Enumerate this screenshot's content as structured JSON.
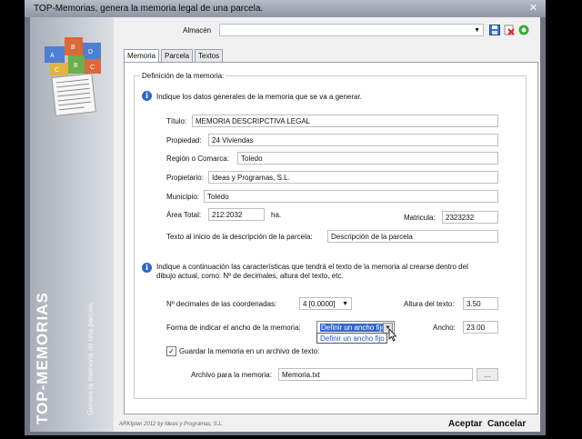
{
  "window": {
    "title": "TOP-Memorias, genera la memoria legal de una parcela.",
    "sidebar_title": "TOP-MEMORIAS",
    "sidebar_subtitle": "Genera la memoria de una parcela.",
    "copyright": "ARKIplan 2012 by Ideas y Programas, S.L."
  },
  "toolbar": {
    "almacen_label": "Almacén",
    "almacen_value": "",
    "icons": [
      "save-icon",
      "delete-icon",
      "refresh-icon"
    ]
  },
  "tabs": [
    {
      "label": "Memoria",
      "active": true
    },
    {
      "label": "Parcela",
      "active": false
    },
    {
      "label": "Textos",
      "active": false
    }
  ],
  "group": {
    "title": "Definición de la memoria:",
    "info1": "Indique los datos generales de la memoria que se va a generar.",
    "info2_line1": "Indique a continuación las características que tendrá el texto de la memoria al crearse dentro del",
    "info2_line2": "dibujo actual, como: Nº de decimales, altura del texto, etc."
  },
  "fields": {
    "titulo_label": "Título:",
    "titulo_value": "MEMORIA DESCRIPCTIVA LEGAL",
    "propiedad_label": "Propiedad:",
    "propiedad_value": "24 Viviendas",
    "region_label": "Región o Comarca:",
    "region_value": "Toledo",
    "propietario_label": "Propietario:",
    "propietario_value": "Ideas y Programas, S.L.",
    "municipio_label": "Municipio:",
    "municipio_value": "Toledo",
    "area_label": "Área Total:",
    "area_value": "212.2032",
    "area_unit": "ha.",
    "matricula_label": "Matricula:",
    "matricula_value": "2323232",
    "texto_inicio_label": "Texto al inicio de la descripción de la parcela:",
    "texto_inicio_value": "Descripción de la parcela",
    "decimales_label": "Nº decimales de las coordenadas:",
    "decimales_value": "4 [0.0000]",
    "altura_label": "Altura del texto:",
    "altura_value": "3.50",
    "forma_label": "Forma de indicar el ancho de la memoria:",
    "forma_value": "Definir un ancho fijo",
    "forma_options": [
      "Definir un ancho fijo"
    ],
    "ancho_label": "Ancho:",
    "ancho_value": "23.00",
    "guardar_label": "Guardar la memoria en un archivo de texto:",
    "guardar_checked": "✓",
    "archivo_label": "Archivo para la memoria:",
    "archivo_value": "Memoria.txt",
    "browse_label": "..."
  },
  "footer": {
    "accept": "Aceptar",
    "cancel": "Cancelar"
  },
  "colors": {
    "selection": "#3366cc",
    "info_icon": "#2f67c2"
  }
}
